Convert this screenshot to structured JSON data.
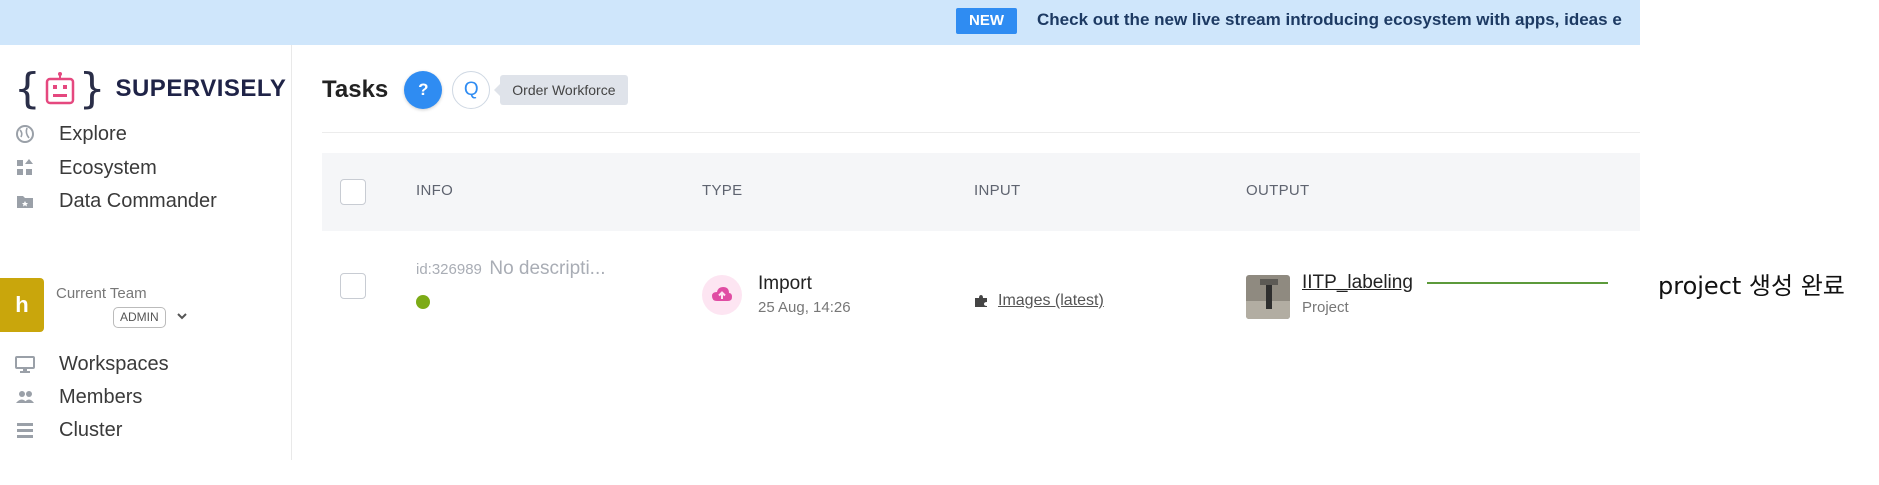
{
  "banner": {
    "badge": "NEW",
    "text": "Check out the new live stream introducing ecosystem with apps, ideas e"
  },
  "sidebar": {
    "brand": "SUPERVISELY",
    "items": [
      {
        "label": "Explore",
        "icon": "globe-icon"
      },
      {
        "label": "Ecosystem",
        "icon": "ecosystem-icon"
      },
      {
        "label": "Data Commander",
        "icon": "folder-icon"
      },
      {
        "label": "Workspaces",
        "icon": "monitor-icon"
      },
      {
        "label": "Members",
        "icon": "users-icon"
      },
      {
        "label": "Cluster",
        "icon": "list-icon"
      }
    ],
    "team": {
      "avatar_letter": "h",
      "label": "Current Team",
      "role": "ADMIN"
    }
  },
  "header": {
    "title": "Tasks",
    "help": "?",
    "q": "Q",
    "order_workforce": "Order Workforce"
  },
  "table": {
    "columns": [
      "INFO",
      "TYPE",
      "INPUT",
      "OUTPUT"
    ],
    "rows": [
      {
        "id": "id:326989",
        "description": "No descripti...",
        "type": "Import",
        "time": "25 Aug, 14:26",
        "input": "Images (latest)",
        "output_name": "IITP_labeling",
        "output_type": "Project"
      }
    ]
  },
  "annotation": {
    "text": "project 생성 완료"
  },
  "colors": {
    "accent": "#2f8cf2",
    "banner_bg": "#cfe6fb",
    "team_avatar": "#c9a60c",
    "status_dot": "#7cab16",
    "callout_line": "#5c9a3b"
  }
}
